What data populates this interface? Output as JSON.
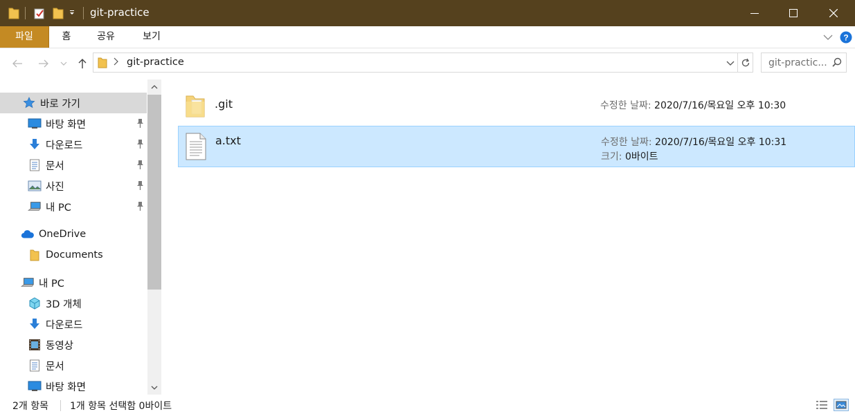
{
  "window": {
    "title": "git-practice",
    "minimize_label": "Minimize",
    "maximize_label": "Maximize",
    "close_label": "Close"
  },
  "ribbon": {
    "tabs": [
      {
        "label": "파일"
      },
      {
        "label": "홈"
      },
      {
        "label": "공유"
      },
      {
        "label": "보기"
      }
    ]
  },
  "address": {
    "path": [
      "git-practice"
    ],
    "search_placeholder": "git-practic..."
  },
  "nav": {
    "items": [
      {
        "label": "바로 가기",
        "icon": "star-icon"
      },
      {
        "label": "바탕 화면",
        "icon": "desktop-icon",
        "pinned": true
      },
      {
        "label": "다운로드",
        "icon": "download-icon",
        "pinned": true
      },
      {
        "label": "문서",
        "icon": "document-icon",
        "pinned": true
      },
      {
        "label": "사진",
        "icon": "picture-icon",
        "pinned": true
      },
      {
        "label": "내 PC",
        "icon": "pc-icon",
        "pinned": true
      },
      {
        "label": "OneDrive",
        "icon": "cloud-icon"
      },
      {
        "label": "Documents",
        "icon": "folder-icon"
      },
      {
        "label": "내 PC",
        "icon": "pc-icon"
      },
      {
        "label": "3D 개체",
        "icon": "cube-icon"
      },
      {
        "label": "다운로드",
        "icon": "download-icon"
      },
      {
        "label": "동영상",
        "icon": "video-icon"
      },
      {
        "label": "문서",
        "icon": "document-icon"
      },
      {
        "label": "바탕 화면",
        "icon": "desktop-icon"
      }
    ]
  },
  "files": [
    {
      "name": ".git",
      "type": "folder",
      "modified_label": "수정한 날짜:",
      "modified_value": "2020/7/16/목요일 오후 10:30"
    },
    {
      "name": "a.txt",
      "type": "text",
      "modified_label": "수정한 날짜:",
      "modified_value": "2020/7/16/목요일 오후 10:31",
      "size_label": "크기:",
      "size_value": "0바이트",
      "selected": true
    }
  ],
  "status": {
    "item_count": "2개 항목",
    "selection": "1개 항목 선택함 0바이트"
  },
  "colors": {
    "titlebar": "#55411e",
    "file_tab": "#c48a23",
    "selection": "#cce8ff",
    "selection_border": "#99d1ff",
    "help": "#1a73d9"
  }
}
